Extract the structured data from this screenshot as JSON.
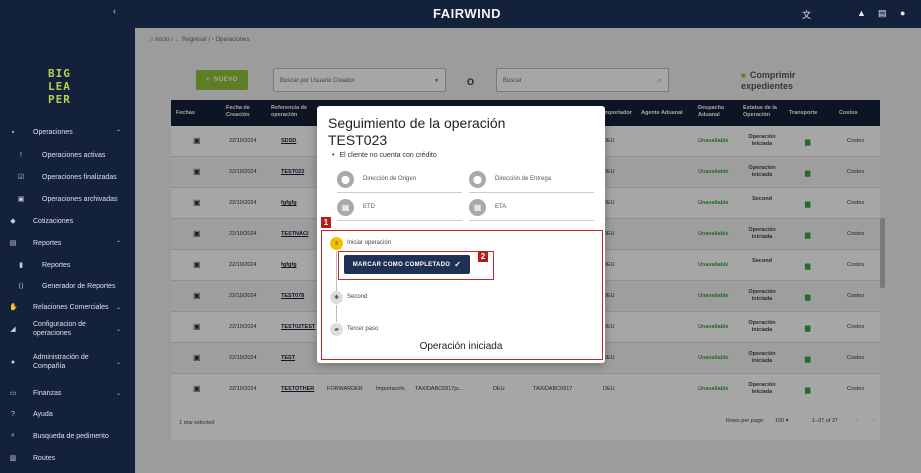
{
  "sidebar": {
    "logo_lines": [
      "BIG",
      "LEA",
      "PER"
    ],
    "items": [
      {
        "label": "Operaciones",
        "icon": "briefcase-icon",
        "glyph": "▪",
        "chev": "⌃"
      },
      {
        "label": "Operaciones activas",
        "icon": "alert-icon",
        "glyph": "!",
        "sub": true
      },
      {
        "label": "Operaciones finalizadas",
        "icon": "check-box-icon",
        "glyph": "☑",
        "sub": true
      },
      {
        "label": "Operaciones archivadas",
        "icon": "archive-icon",
        "glyph": "▣",
        "sub": true
      },
      {
        "label": "Cotizaciones",
        "icon": "tag-icon",
        "glyph": "◆"
      },
      {
        "label": "Reportes",
        "icon": "report-icon",
        "glyph": "▤",
        "chev": "⌃"
      },
      {
        "label": "Reportes",
        "icon": "bar-chart-icon",
        "glyph": "▮",
        "sub": true
      },
      {
        "label": "Generador de Reportes",
        "icon": "code-icon",
        "glyph": "⟨⟩",
        "sub": true
      },
      {
        "label": "Relaciones Comerciales",
        "icon": "handshake-icon",
        "glyph": "✋",
        "chev": "⌄"
      },
      {
        "label": "Configuracion de operaciones",
        "icon": "settings-icon",
        "glyph": "◢",
        "chev": "⌄"
      },
      {
        "label": "Administración de Compañía",
        "icon": "company-icon",
        "glyph": "●",
        "chev": "⌄"
      },
      {
        "label": "Finanzas",
        "icon": "money-icon",
        "glyph": "▭",
        "chev": "⌄"
      },
      {
        "label": "Ayuda",
        "icon": "help-icon",
        "glyph": "?"
      },
      {
        "label": "Busqueda de pedimento",
        "icon": "search-icon",
        "glyph": "⌕"
      },
      {
        "label": "Routes",
        "icon": "map-icon",
        "glyph": "▥"
      }
    ]
  },
  "topbar": {
    "brand": "FAIRWIND"
  },
  "breadcrumb": {
    "home": "Inicio",
    "back": "Regresar",
    "current": "Operaciones"
  },
  "toolbar": {
    "new_label": "NUEVO",
    "creator_placeholder": "Buscar por Usuario Creador",
    "or_label": "O",
    "search_placeholder": "Buscar",
    "compress_label": "Comprimir expedientes"
  },
  "table": {
    "headers": [
      "Fechas",
      "Fecha de Creación",
      "Referencia de operación",
      "Importador",
      "Agente Aduanal",
      "Despacho Aduanal",
      "Estatus de la Operación",
      "Transporte",
      "Costos"
    ],
    "rows": [
      {
        "date": "22/10/2024",
        "ref": "SDSD",
        "importer": "DEU",
        "customs": "Unavailable",
        "status": "Operación iniciada",
        "costs": "Costos"
      },
      {
        "date": "22/10/2024",
        "ref": "TEST023",
        "importer": "DEU",
        "customs": "Unavailable",
        "status": "Operación iniciada",
        "costs": "Costos"
      },
      {
        "date": "22/10/2024",
        "ref": "fgfgfg",
        "importer": "DEU",
        "customs": "Unavailable",
        "status": "Second",
        "costs": "Costos"
      },
      {
        "date": "22/10/2024",
        "ref": "TESTNACI",
        "importer": "DEU",
        "customs": "Unavailable",
        "status": "Operación iniciada",
        "costs": "Costos"
      },
      {
        "date": "22/10/2024",
        "ref": "fgfgfg",
        "importer": "DEU",
        "customs": "Unavailable",
        "status": "Second",
        "costs": "Costos"
      },
      {
        "date": "22/10/2024",
        "ref": "TEST078",
        "importer": "DEU",
        "customs": "Unavailable",
        "status": "Operación iniciada",
        "costs": "Costos"
      },
      {
        "date": "22/10/2024",
        "ref": "TEST02TEST",
        "importer": "DEU",
        "customs": "Unavailable",
        "status": "Operación iniciada",
        "costs": "Costos"
      },
      {
        "date": "22/10/2024",
        "ref": "TEST",
        "importer": "DEU",
        "customs": "Unavailable",
        "status": "Operación iniciada",
        "costs": "Costos"
      },
      {
        "date": "22/10/2024",
        "ref": "TESTOTHER",
        "agent": "FORWARDER",
        "kind": "Importación",
        "taxid": "TAXIDABC6917ju...",
        "country": "DEU",
        "taxid2": "TAXIDABC6917",
        "importer": "DEU",
        "customs": "Unavailable",
        "status": "Operación iniciada",
        "costs": "Costos"
      },
      {
        "date": "",
        "ref": "",
        "importer": "",
        "customs": "",
        "status": "Operación",
        "costs": ""
      }
    ],
    "footer": {
      "selected": "1 row selected",
      "rows_per_page_label": "Rows per page:",
      "rows_per_page": "100",
      "range": "1–37 of 37"
    }
  },
  "modal": {
    "title_line1": "Seguimiento de la operación",
    "title_line2": "TEST023",
    "subtitle": "El cliente no cuenta con crédito",
    "fields": {
      "origin": "Dirección de Origen",
      "destination": "Dirección de Entrega",
      "etd": "ETD",
      "eta": "ETA"
    },
    "steps": [
      {
        "label": "Iniciar operación",
        "icon": "checklist-icon"
      },
      {
        "label": "Second",
        "icon": "gear-icon"
      },
      {
        "label": "Tercer paso",
        "icon": "truck-icon"
      }
    ],
    "complete_button": "MARCAR COMO COMPLETADO",
    "current_state": "Operación iniciada",
    "annotation_1": "1",
    "annotation_2": "2"
  },
  "colors": {
    "sidebar": "#14213a",
    "accent_green": "#8fc23a",
    "annotation_red": "#c62828",
    "button_navy": "#1e3154"
  }
}
